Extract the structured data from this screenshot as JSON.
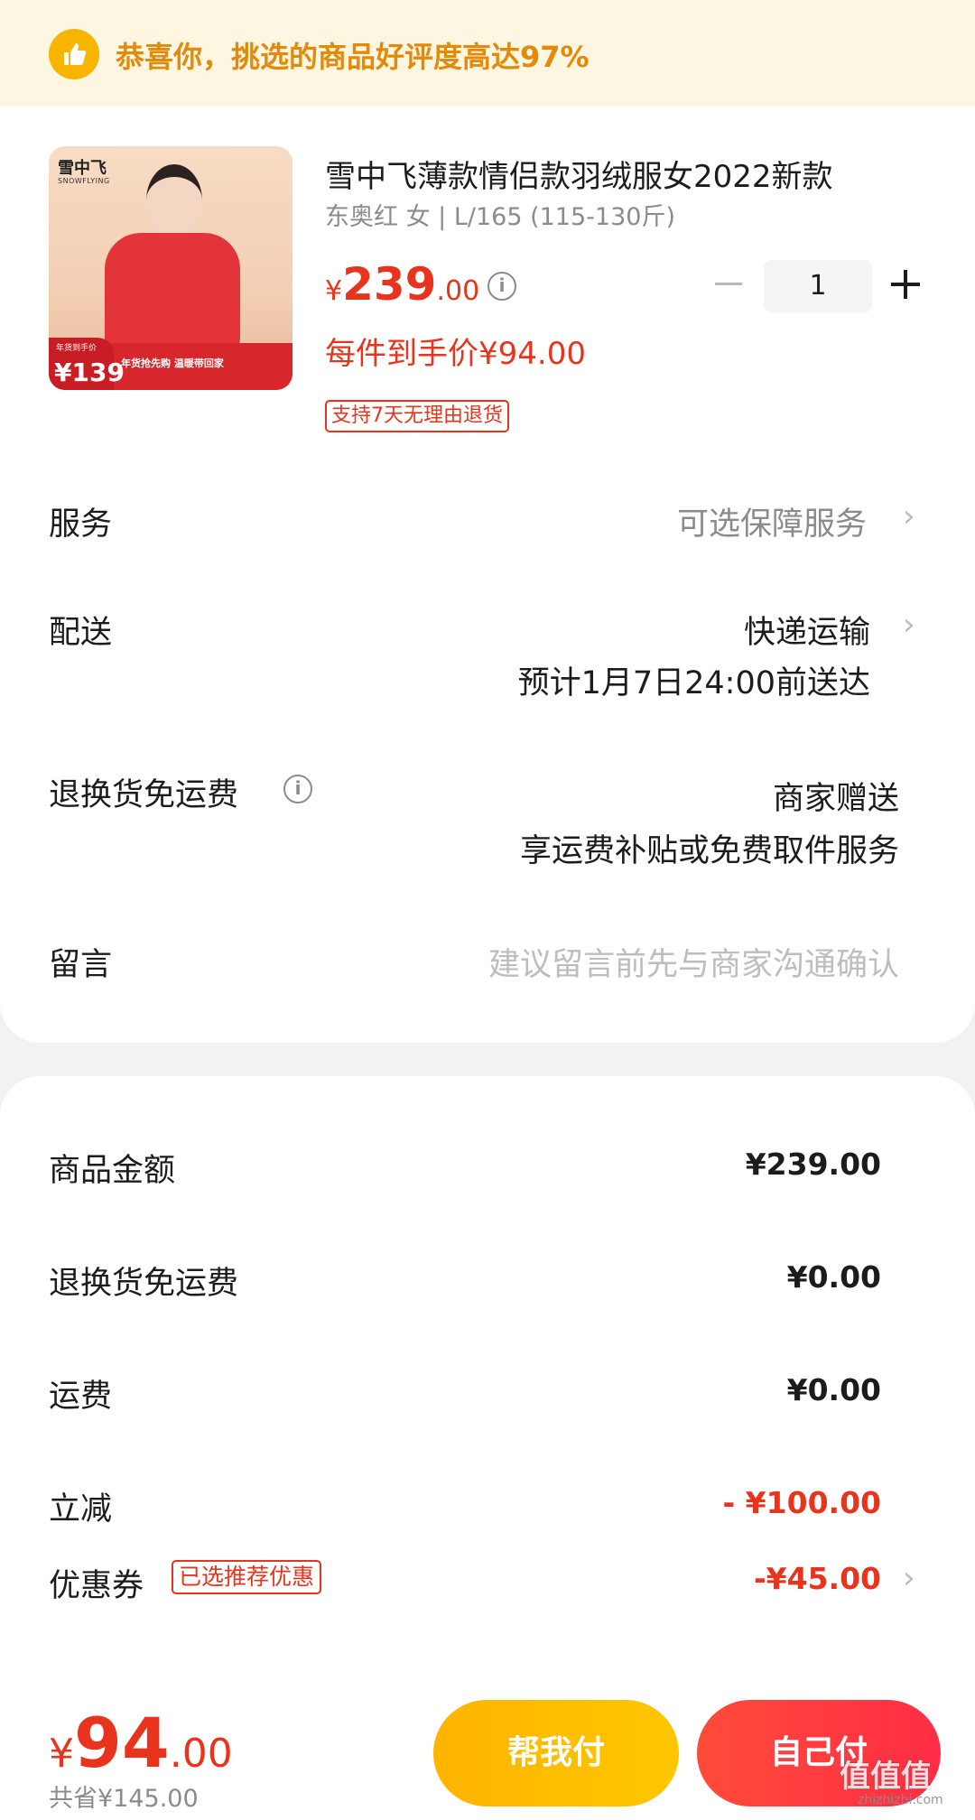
{
  "banner": {
    "text": "恭喜你，挑选的商品好评度高达97%",
    "icon": "thumbs-up-icon"
  },
  "product": {
    "title": "雪中飞薄款情侣款羽绒服女2022新款",
    "spec": "东奥红 女 | L/165 (115-130斤)",
    "price_symbol": "¥",
    "price_int": "239",
    "price_dec": ".00",
    "unit_price": "每件到手价¥94.00",
    "return_tag": "支持7天无理由退货",
    "quantity": "1",
    "image": {
      "brand": "雪中飞",
      "brand_en": "SNOWFLYING",
      "badge_label": "年货到手价",
      "badge_value": "¥139",
      "band_text": "年货抢先购 温暖带回家"
    }
  },
  "rows": {
    "service": {
      "label": "服务",
      "value": "可选保障服务"
    },
    "delivery": {
      "label": "配送",
      "value": "快递运输",
      "eta": "预计1月7日24:00前送达"
    },
    "return_free": {
      "label": "退换货免运费",
      "value": "商家赠送",
      "sub": "享运费补贴或免费取件服务"
    },
    "message": {
      "label": "留言",
      "placeholder": "建议留言前先与商家沟通确认"
    }
  },
  "summary": {
    "goods_amount": {
      "label": "商品金额",
      "value": "¥239.00"
    },
    "return_shipping": {
      "label": "退换货免运费",
      "value": "¥0.00"
    },
    "shipping": {
      "label": "运费",
      "value": "¥0.00"
    },
    "discount": {
      "label": "立减",
      "value": "- ¥100.00"
    },
    "coupon": {
      "label": "优惠券",
      "tag": "已选推荐优惠",
      "value": "-¥45.00"
    }
  },
  "footer": {
    "total_symbol": "¥",
    "total_int": "94",
    "total_dec": ".00",
    "saved": "共省¥145.00",
    "help_pay": "帮我付",
    "self_pay": "自己付",
    "watermark": "值值值",
    "watermark_sub": "zhizhizhi.com"
  },
  "colors": {
    "accent_red": "#e8341c",
    "banner_bg": "#fdf6e1",
    "banner_text": "#e38a0b",
    "help_button": "#ffb400",
    "self_button": "#ff3a3f"
  }
}
